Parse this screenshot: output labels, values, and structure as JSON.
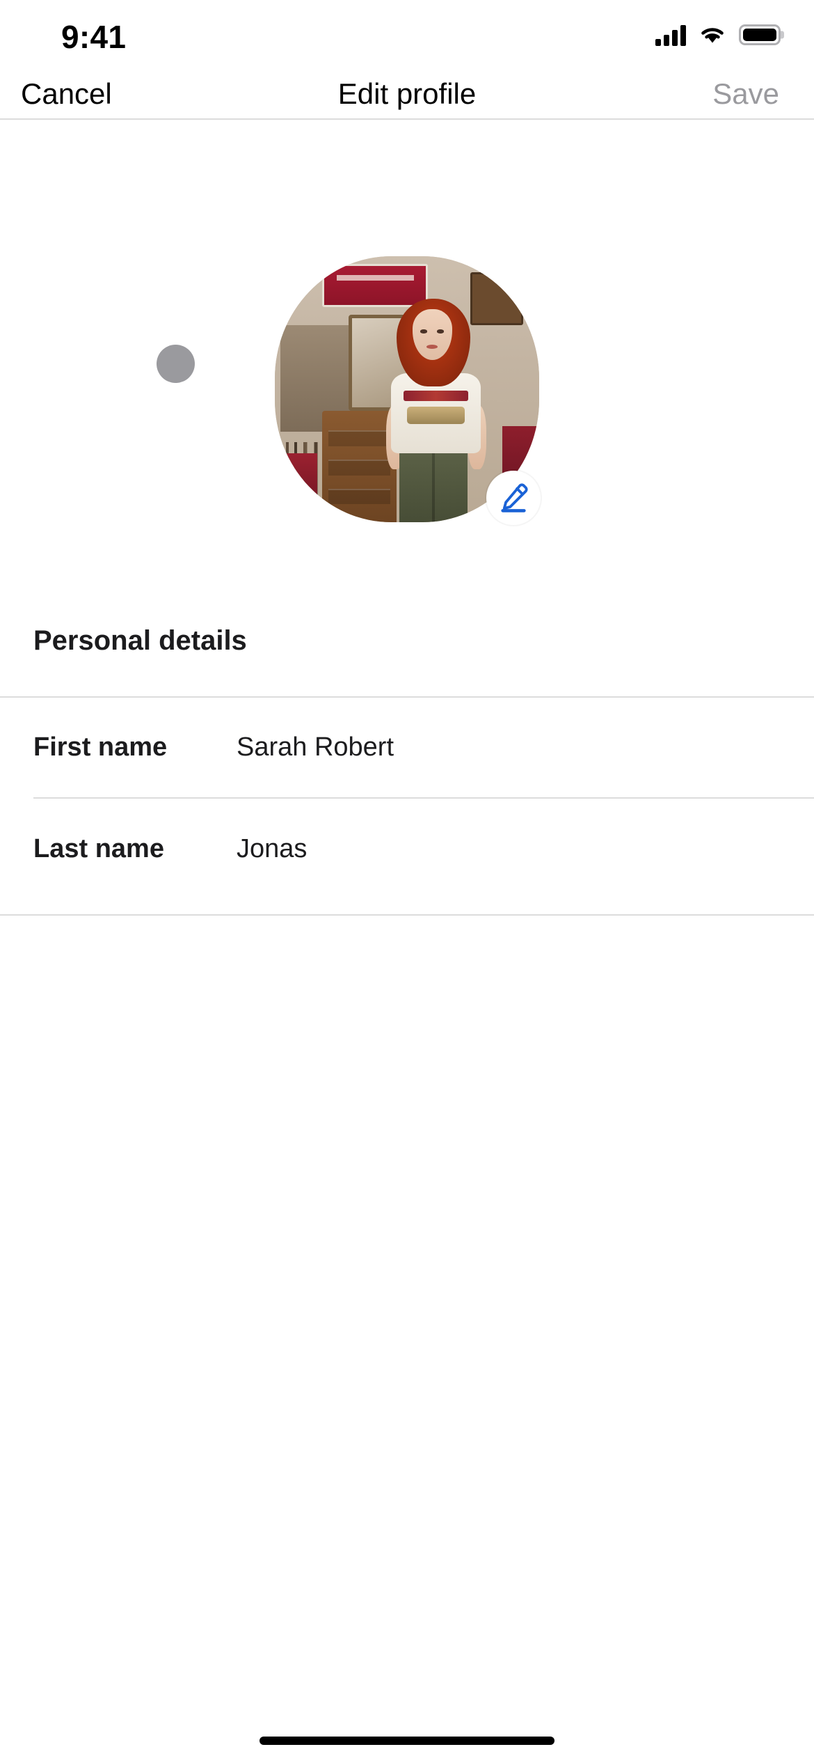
{
  "status_bar": {
    "time": "9:41",
    "icons": {
      "cellular": "cellular-signal-icon",
      "wifi": "wifi-icon",
      "battery": "battery-full-icon"
    },
    "battery_level_percent": 100
  },
  "nav_bar": {
    "cancel_label": "Cancel",
    "title": "Edit profile",
    "save_label": "Save",
    "save_enabled": false,
    "save_color": "#9a9a9e"
  },
  "avatar": {
    "edit_badge_icon": "pencil-edit-icon",
    "edit_badge_color": "#1a62d6",
    "placeholder_dot_color": "#9a9a9e",
    "photo_alt": "Profile photo of a woman with red curly hair wearing a white graphic t-shirt and olive green pants, standing in a vintage shop"
  },
  "personal_details": {
    "section_title": "Personal details",
    "fields": [
      {
        "label": "First name",
        "value": "Sarah Robert"
      },
      {
        "label": "Last name",
        "value": "Jonas"
      }
    ]
  },
  "system": {
    "home_indicator": "home-indicator"
  }
}
